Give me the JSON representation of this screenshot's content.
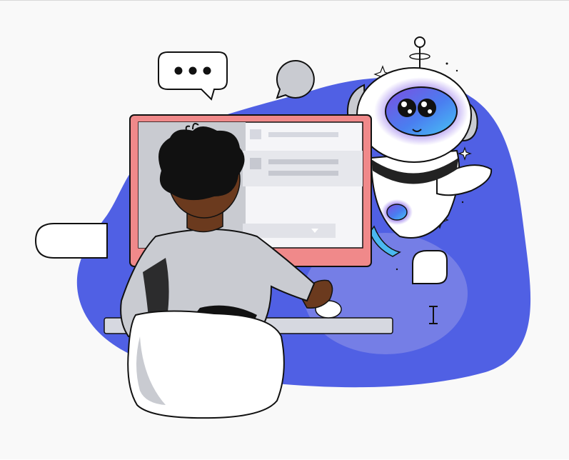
{
  "illustration": {
    "subject": "person-at-computer-with-robot-assistant",
    "colors": {
      "background": "#f9f9f9",
      "blob": "#5060e4",
      "blob_light": "#8d92e8",
      "monitor_frame": "#f0898a",
      "screen_bg": "#f5f5f8",
      "screen_row": "#d6d8e0",
      "skin": "#6b3a1e",
      "hair": "#111111",
      "shirt": "#c9cbd1",
      "chair": "#ffffff",
      "robot_body": "#ffffff",
      "robot_glow": "#8e6cf0",
      "outline": "#111111"
    },
    "icons": [
      "chat-bubble-ellipsis-icon",
      "speech-bubble-icon",
      "sparkle-icon",
      "text-cursor-icon"
    ]
  }
}
